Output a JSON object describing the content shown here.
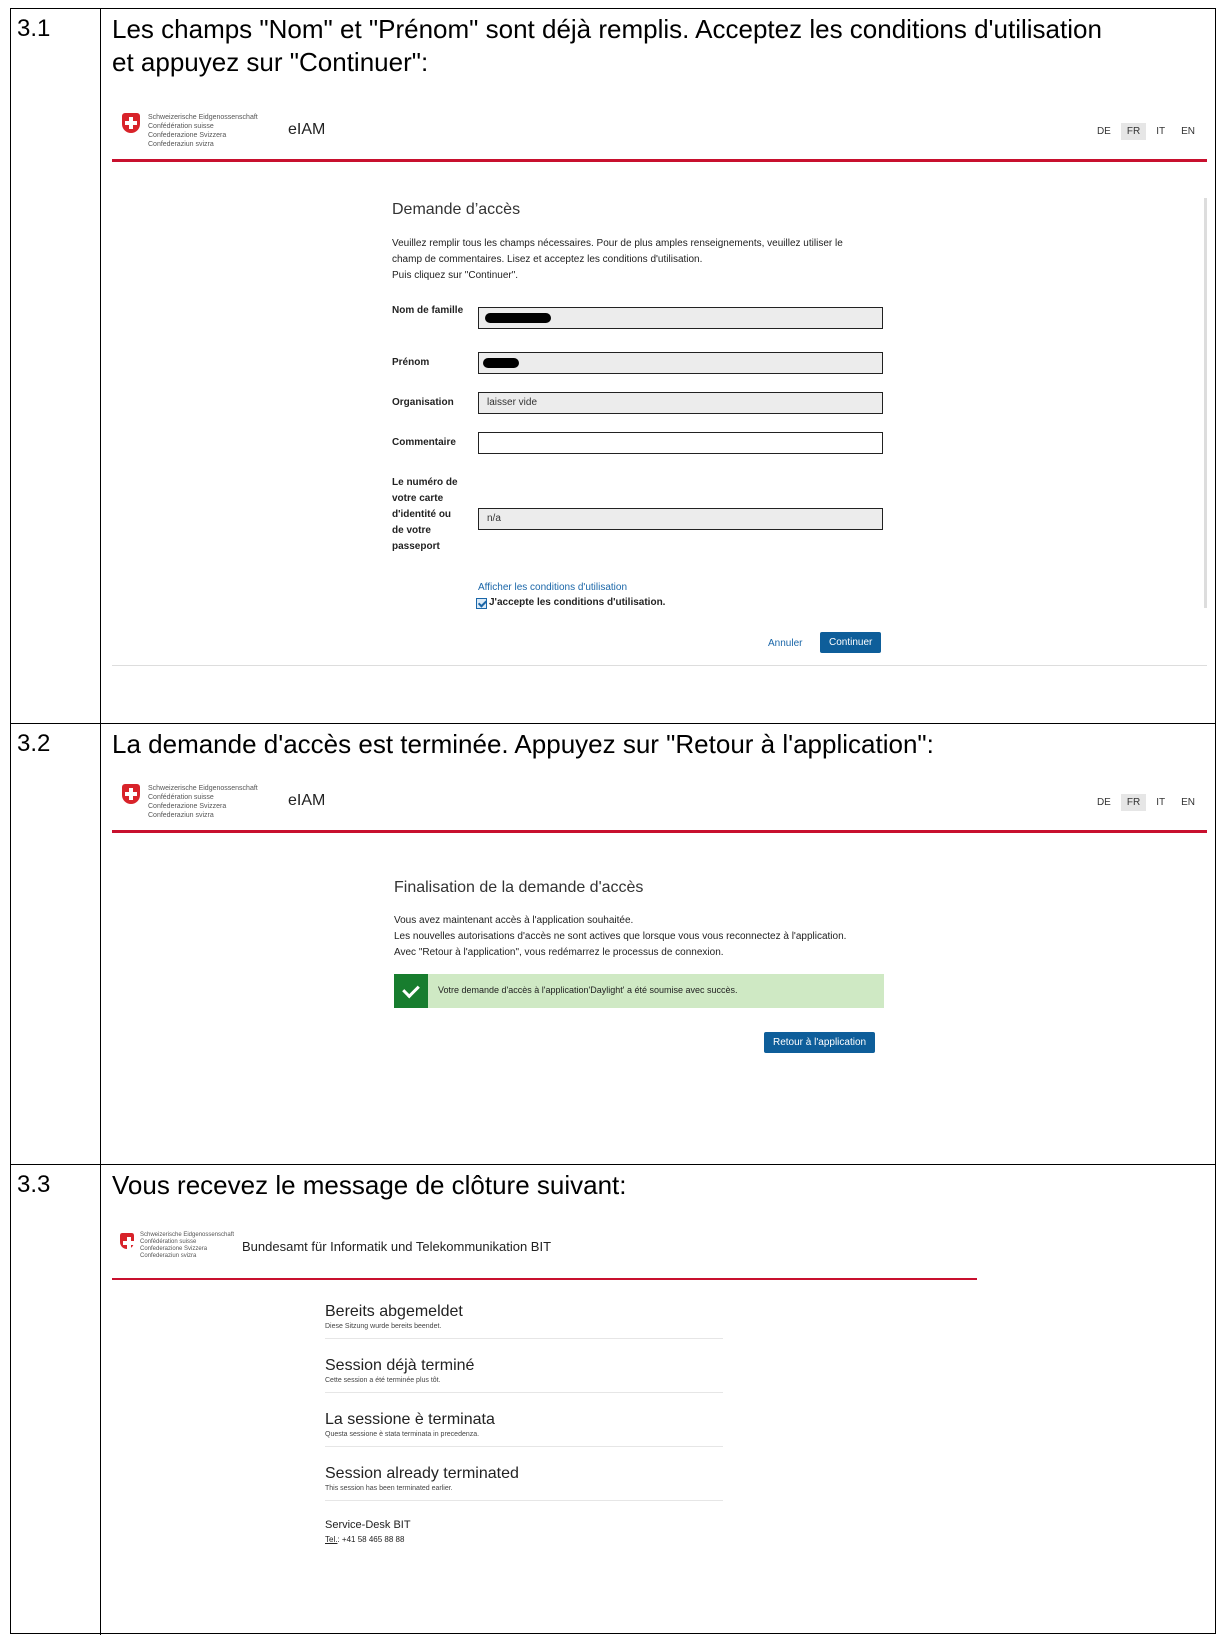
{
  "steps": [
    {
      "num": "3.1",
      "text": "Les champs \"Nom\" et \"Prénom\" sont déjà remplis. Acceptez les conditions d'utilisation et appuyez sur \"Continuer\":"
    },
    {
      "num": "3.2",
      "text": "La demande d'accès est terminée. Appuyez sur \"Retour à l'application\":"
    },
    {
      "num": "3.3",
      "text": "Vous recevez le message de clôture suivant:"
    }
  ],
  "federal_lines": [
    "Schweizerische Eidgenossenschaft",
    "Confédération suisse",
    "Confederazione Svizzera",
    "Confederaziun svizra"
  ],
  "app_name": "eIAM",
  "languages": [
    "DE",
    "FR",
    "IT",
    "EN"
  ],
  "active_language": "FR",
  "form": {
    "title": "Demande d’accès",
    "intro": [
      "Veuillez remplir tous les champs nécessaires. Pour de plus amples renseignements, veuillez utiliser le",
      "champ de commentaires. Lisez et acceptez les conditions d'utilisation.",
      "Puis cliquez sur \"Continuer\"."
    ],
    "label_nom": "Nom de famille",
    "label_prenom": "Prénom",
    "label_org": "Organisation",
    "org_value": "laisser vide",
    "label_comment": "Commentaire",
    "label_id": "Le numéro de votre carte d'identité ou de votre passeport",
    "id_value": "n/a",
    "terms_link": "Afficher les conditions d'utilisation",
    "accept_label": "J'accepte les conditions d'utilisation.",
    "accept_checked": true,
    "cancel": "Annuler",
    "continue": "Continuer"
  },
  "final": {
    "title": "Finalisation de la demande d'accès",
    "lines": [
      "Vous avez maintenant accès à l'application souhaitée.",
      "Les nouvelles autorisations d'accès ne sont actives que lorsque vous vous reconnectez à l'application.",
      "Avec \"Retour à l'application\", vous redémarrez le processus de connexion."
    ],
    "success": "Votre demande d'accès à l'application'Daylight' a été soumise avec succès.",
    "back_button": "Retour à l'application"
  },
  "closing": {
    "org": "Bundesamt für Informatik und Telekommunikation BIT",
    "sessions": [
      {
        "h": "Bereits abgemeldet",
        "s": "Diese Sitzung wurde bereits beendet."
      },
      {
        "h": "Session déjà terminé",
        "s": "Cette session a été terminée plus tôt."
      },
      {
        "h": "La sessione è terminata",
        "s": "Questa sessione è stata terminata in precedenza."
      },
      {
        "h": "Session already terminated",
        "s": "This session has been terminated earlier."
      }
    ],
    "service_desk": "Service-Desk BIT",
    "tel_label": "Tel.",
    "tel": ": +41 58 465 88 88"
  }
}
